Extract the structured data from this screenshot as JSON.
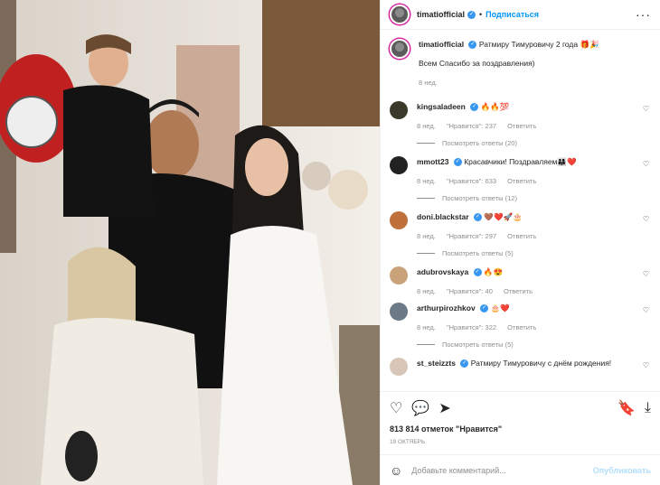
{
  "header": {
    "username": "timatiofficial",
    "separator": "•",
    "follow_label": "Подписаться",
    "more_label": "···"
  },
  "caption": {
    "username": "timatiofficial",
    "text": "Ратмиру Тимуровичу 2 года 🎁🎉",
    "line2": "Всем Спасибо за поздравления)",
    "time": "8 нед."
  },
  "comments": [
    {
      "username": "kingsaladeen",
      "text": "🔥🔥💯",
      "time": "8 нед.",
      "likes": "\"Нравится\": 237",
      "reply": "Ответить",
      "view_replies": "Посмотреть ответы (20)",
      "avatar_color": "#3a3a2a"
    },
    {
      "username": "mmott23",
      "text": "Красавчики! Поздравляем👨‍👩‍👧❤️",
      "time": "8 нед.",
      "likes": "\"Нравится\": 633",
      "reply": "Ответить",
      "view_replies": "Посмотреть ответы (12)",
      "avatar_color": "#222222"
    },
    {
      "username": "doni.blackstar",
      "text": "🤎❤️🚀🎂",
      "time": "8 нед.",
      "likes": "\"Нравится\": 297",
      "reply": "Ответить",
      "view_replies": "Посмотреть ответы (5)",
      "avatar_color": "#c0703a"
    },
    {
      "username": "adubrovskaya",
      "text": "🔥😍",
      "time": "8 нед.",
      "likes": "\"Нравится\": 40",
      "reply": "Ответить",
      "view_replies": "",
      "avatar_color": "#c9a27a"
    },
    {
      "username": "arthurpirozhkov",
      "text": "🎂❤️",
      "time": "8 нед.",
      "likes": "\"Нравится\": 322",
      "reply": "Ответить",
      "view_replies": "Посмотреть ответы (5)",
      "avatar_color": "#6b7a86"
    },
    {
      "username": "st_steizzts",
      "text": "Ратмиру Тимуровичу с днём рождения!",
      "time": "",
      "likes": "",
      "reply": "",
      "view_replies": "",
      "avatar_color": "#d8c7b8"
    }
  ],
  "actions": {
    "likes": "813 814 отметок \"Нравится\"",
    "date": "19 октябрь"
  },
  "add_comment": {
    "placeholder": "Добавьте комментарий...",
    "publish": "Опубликовать"
  }
}
